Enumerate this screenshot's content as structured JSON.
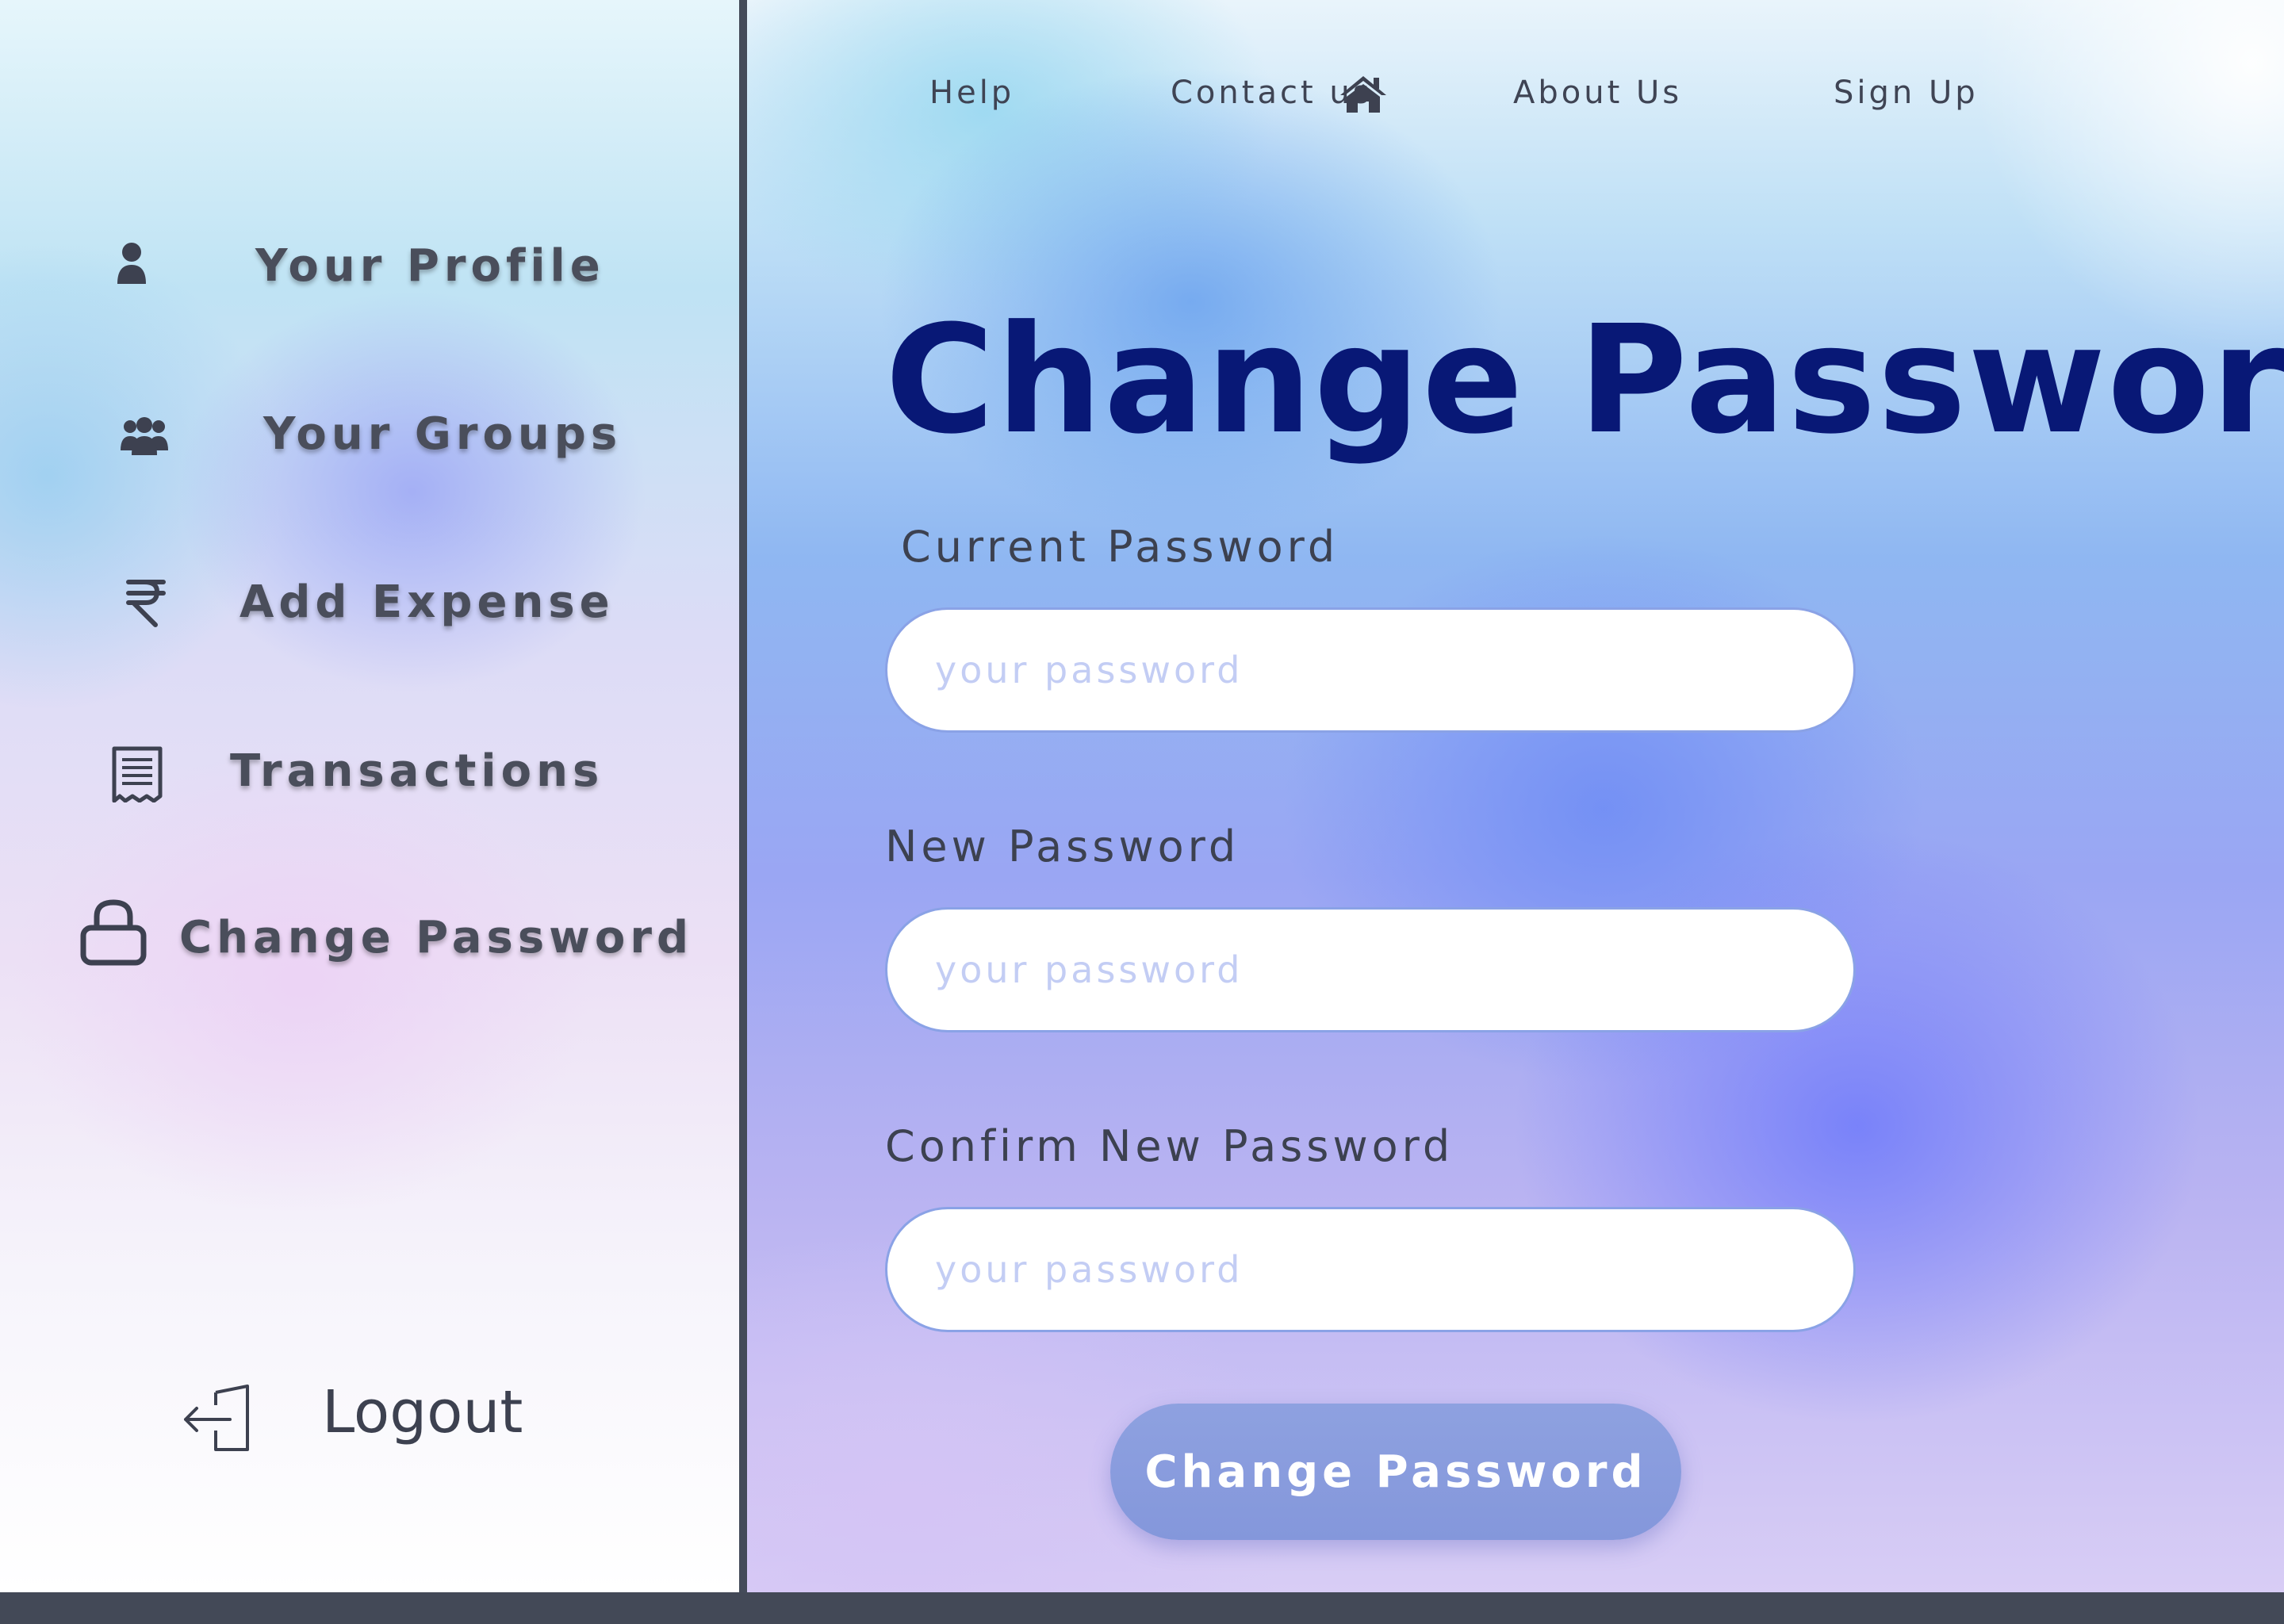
{
  "sidebar": {
    "items": [
      {
        "label": "Your Profile",
        "icon": "person-icon"
      },
      {
        "label": "Your Groups",
        "icon": "group-icon"
      },
      {
        "label": "Add Expense",
        "icon": "rupee-icon"
      },
      {
        "label": "Transactions",
        "icon": "receipt-icon"
      },
      {
        "label": "Change Password",
        "icon": "lock-icon"
      }
    ],
    "logout": {
      "label": "Logout",
      "icon": "logout-icon"
    }
  },
  "nav": {
    "links": [
      "Help",
      "Contact us",
      "About Us",
      "Sign Up"
    ],
    "home_icon": "home-icon"
  },
  "main": {
    "title": "Change Password",
    "fields": [
      {
        "label": "Current Password",
        "placeholder": "your password"
      },
      {
        "label": "New Password",
        "placeholder": "your password"
      },
      {
        "label": "Confirm New Password",
        "placeholder": "your password"
      }
    ],
    "submit_label": "Change Password"
  },
  "colors": {
    "title": "#081876",
    "sidebar_text": "#4a4e5b",
    "divider": "#444b59",
    "button": "#8a9cde"
  }
}
